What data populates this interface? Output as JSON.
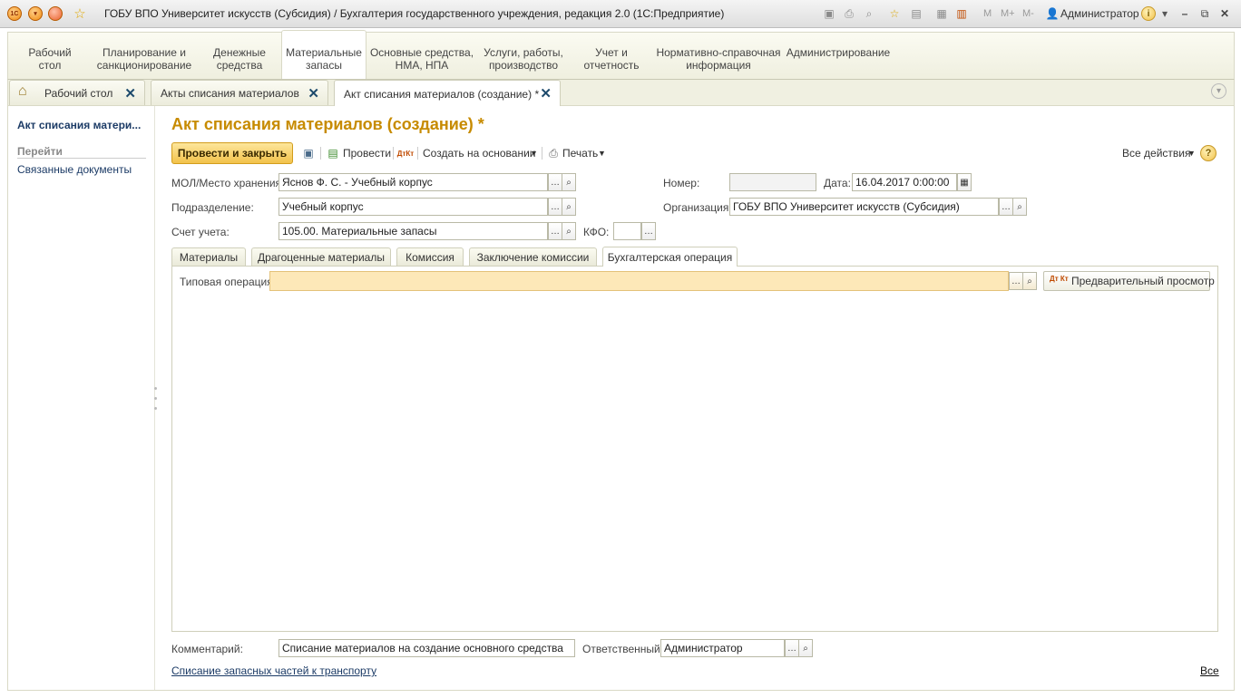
{
  "window": {
    "title": "ГОБУ ВПО Университет искусств (Субсидия) / Бухгалтерия государственного учреждения, редакция 2.0  (1С:Предприятие)",
    "logo_text": "1С",
    "memory_buttons": [
      "M",
      "M+",
      "M-"
    ],
    "user": "Администратор"
  },
  "sections": [
    {
      "label": "Рабочий\nстол"
    },
    {
      "label": "Планирование и\nсанкционирование"
    },
    {
      "label": "Денежные\nсредства"
    },
    {
      "label": "Материальные\nзапасы"
    },
    {
      "label": "Основные средства,\nНМА, НПА"
    },
    {
      "label": "Услуги, работы,\nпроизводство"
    },
    {
      "label": "Учет и\nотчетность"
    },
    {
      "label": "Нормативно-справочная\nинформация"
    },
    {
      "label": "Администрирование"
    }
  ],
  "open_tabs": [
    {
      "label": "Рабочий стол"
    },
    {
      "label": "Акты списания материалов"
    },
    {
      "label": "Акт списания материалов (создание) *"
    }
  ],
  "sidebar": {
    "title": "Акт списания матери...",
    "go_label": "Перейти",
    "link": "Связанные документы"
  },
  "document": {
    "title": "Акт списания материалов (создание) *"
  },
  "toolbar": {
    "post_close": "Провести и закрыть",
    "post": "Провести",
    "create_based": "Создать на основании",
    "print": "Печать",
    "all_actions": "Все действия",
    "help": "?"
  },
  "form": {
    "mol_label": "МОЛ/Место хранения:",
    "mol_value": "Яснов Ф. С. - Учебный корпус",
    "dept_label": "Подразделение:",
    "dept_value": "Учебный корпус",
    "account_label": "Счет учета:",
    "account_value": "105.00. Материальные запасы",
    "kfo_label": "КФО:",
    "kfo_value": "",
    "number_label": "Номер:",
    "number_value": "",
    "date_label": "Дата:",
    "date_value": "16.04.2017  0:00:00",
    "org_label": "Организация:",
    "org_value": "ГОБУ ВПО Университет искусств (Субсидия)"
  },
  "doc_tabs": [
    {
      "label": "Материалы"
    },
    {
      "label": "Драгоценные материалы"
    },
    {
      "label": "Комиссия"
    },
    {
      "label": "Заключение комиссии"
    },
    {
      "label": "Бухгалтерская операция"
    }
  ],
  "accounting": {
    "typical_op_label": "Типовая операция:",
    "typical_op_value": "",
    "preview_btn": "Предварительный просмотр",
    "dtkt_icon_text": "Дт Кт"
  },
  "footer": {
    "comment_label": "Комментарий:",
    "comment_value": "Списание материалов на создание основного средства",
    "responsible_label": "Ответственный:",
    "responsible_value": "Администратор",
    "link": "Списание запасных частей к транспорту",
    "all_link": "Все"
  },
  "colors": {
    "accent": "#c78b00",
    "required_field": "#fde8b8",
    "primary_button": "#f2c24b",
    "link": "#1c3b66"
  }
}
